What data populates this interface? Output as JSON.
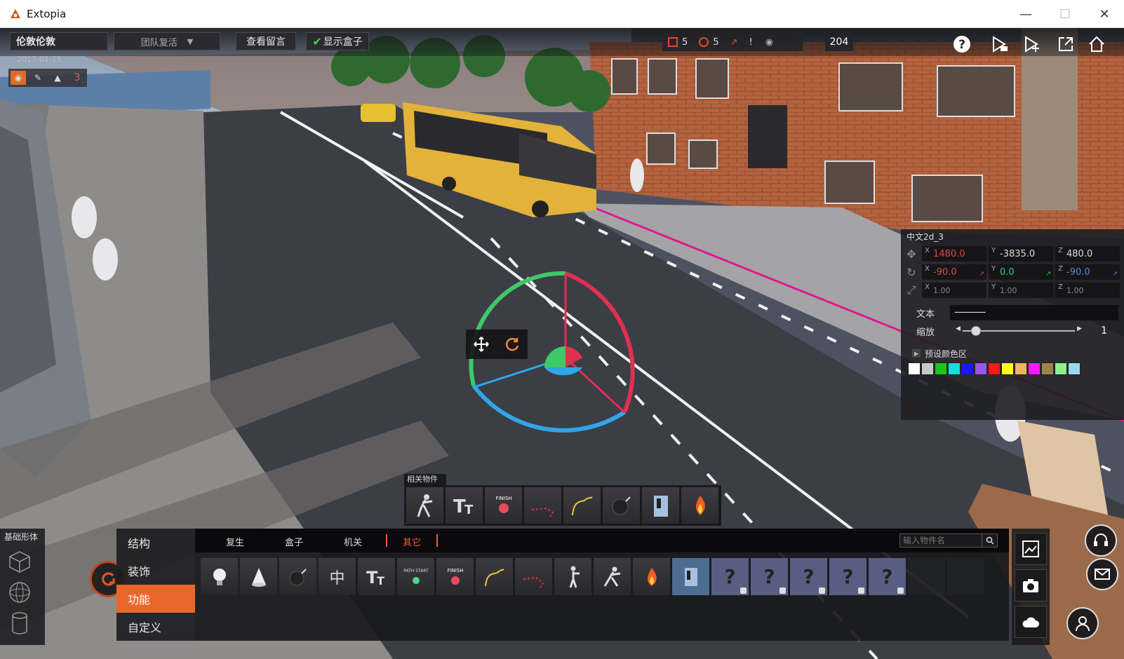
{
  "window": {
    "title": "Extopia",
    "controls": [
      "minimize",
      "maximize",
      "close"
    ]
  },
  "hud": {
    "map_name": "伦敦伦敦",
    "date": "2017-01-15",
    "team_mode": "团队复活",
    "view_messages": "查看留言",
    "show_boxes_label": "显示盒子",
    "show_boxes_checked": true,
    "mini_tools": [
      "camera-icon",
      "pencil-icon",
      "pin-icon",
      "3"
    ],
    "stats": {
      "first": "5",
      "second": "5",
      "third": "!"
    },
    "count": "204",
    "top_icons": [
      "help-icon",
      "play-camera-icon",
      "play-cursor-icon",
      "export-icon",
      "home-icon"
    ]
  },
  "properties": {
    "object_name": "中文2d_3",
    "position": {
      "x": "1480.0",
      "y": "-3835.0",
      "z": "480.0"
    },
    "rotation": {
      "x": "-90.0",
      "y": "0.0",
      "z": "-90.0"
    },
    "scale": {
      "x": "1.00",
      "y": "1.00",
      "z": "1.00"
    },
    "text_label": "文本",
    "text_value": "------------",
    "scale_label": "缩放",
    "scale_value": "1",
    "scale_slider_fraction": 0.08,
    "preset_colors_label": "预设颜色区",
    "preset_colors": [
      "#ffffff",
      "#c8c8c8",
      "#18c818",
      "#12e0d8",
      "#1818ff",
      "#9a58e8",
      "#ff1818",
      "#ffff18",
      "#f0b460",
      "#ff18ff",
      "#a08050",
      "#8cf08c",
      "#9ad8f0"
    ]
  },
  "related": {
    "label": "相关物件",
    "items": [
      "soldier-icon",
      "text-tool-icon",
      "finish-marker-icon",
      "path-dashed-icon",
      "path-curve-icon",
      "bomb-icon",
      "door-icon",
      "fire-icon"
    ]
  },
  "basic_shapes": {
    "title": "基础形体",
    "items": [
      "cube-icon",
      "sphere-icon",
      "cylinder-icon"
    ]
  },
  "categories": {
    "items": [
      "结构",
      "装饰",
      "功能",
      "自定义"
    ],
    "active_index": 2
  },
  "palette": {
    "tabs": [
      "复生",
      "盒子",
      "机关",
      "其它"
    ],
    "active_tab": "其它",
    "search_placeholder": "输入物件名",
    "items": [
      "bulb-icon",
      "cone-icon",
      "bomb-icon",
      "chinese-text-icon",
      "text-tool-icon",
      "path-start-icon",
      "finish-marker-icon",
      "path-curve-icon",
      "path-dashed-icon",
      "soldier-standing-icon",
      "soldier-crouch-icon",
      "fire-icon",
      "door-icon",
      "locked-item",
      "locked-item",
      "locked-item",
      "locked-item",
      "locked-item",
      "empty-slot",
      "empty-slot"
    ],
    "chinese_glyph": "中",
    "path_start_text": "PATH START",
    "finish_text": "FINISH",
    "locked_glyph": "?"
  },
  "side_tools": [
    "screenshot-frame-icon",
    "camera-icon",
    "cloud-icon"
  ],
  "round_buttons": [
    "headset-icon",
    "mail-icon",
    "user-icon"
  ]
}
